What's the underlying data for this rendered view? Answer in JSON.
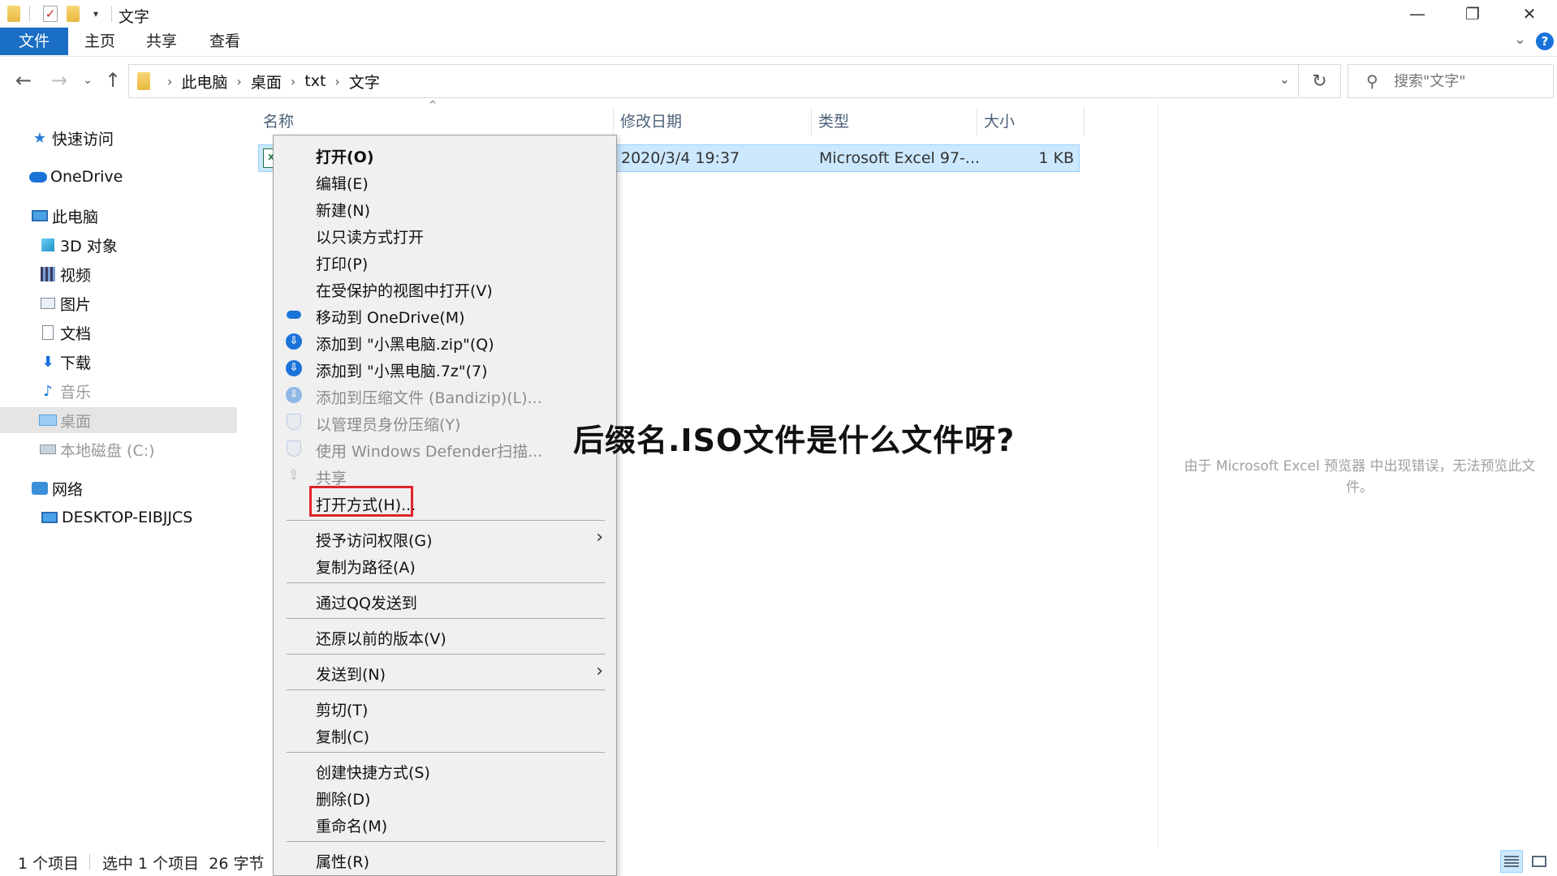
{
  "window": {
    "title": "文字",
    "controls": {
      "minimize": "—",
      "maximize": "❐",
      "close": "✕"
    }
  },
  "ribbon": {
    "tabs": [
      "文件",
      "主页",
      "共享",
      "查看"
    ],
    "help": "?"
  },
  "address": {
    "breadcrumbs": [
      "此电脑",
      "桌面",
      "txt",
      "文字"
    ],
    "search_placeholder": "搜索\"文字\""
  },
  "nav": {
    "items": [
      {
        "label": "快速访问",
        "icon": "star-icon"
      },
      {
        "label": "OneDrive",
        "icon": "onedrive-icon"
      },
      {
        "label": "此电脑",
        "icon": "this-pc-icon"
      },
      {
        "label": "3D 对象",
        "icon": "3d-objects-icon"
      },
      {
        "label": "视频",
        "icon": "video-icon"
      },
      {
        "label": "图片",
        "icon": "pictures-icon"
      },
      {
        "label": "文档",
        "icon": "documents-icon"
      },
      {
        "label": "下载",
        "icon": "download-icon"
      },
      {
        "label": "音乐",
        "icon": "music-icon"
      },
      {
        "label": "桌面",
        "icon": "desktop-icon"
      },
      {
        "label": "本地磁盘 (C:)",
        "icon": "drive-icon"
      },
      {
        "label": "网络",
        "icon": "network-icon"
      },
      {
        "label": "DESKTOP-EIBJJCS",
        "icon": "computer-icon"
      }
    ]
  },
  "columns": [
    "名称",
    "修改日期",
    "类型",
    "大小"
  ],
  "file": {
    "modified": "2020/3/4 19:37",
    "type": "Microsoft Excel 97-...",
    "size": "1 KB"
  },
  "context_menu": {
    "items": [
      "打开(O)",
      "编辑(E)",
      "新建(N)",
      "以只读方式打开",
      "打印(P)",
      "在受保护的视图中打开(V)",
      "移动到 OneDrive(M)",
      "添加到 \"小黑电脑.zip\"(Q)",
      "添加到 \"小黑电脑.7z\"(7)",
      "添加到压缩文件 (Bandizip)(L)...",
      "以管理员身份压缩(Y)",
      "使用 Windows Defender扫描...",
      "共享",
      "打开方式(H)...",
      "授予访问权限(G)",
      "复制为路径(A)",
      "通过QQ发送到",
      "还原以前的版本(V)",
      "发送到(N)",
      "剪切(T)",
      "复制(C)",
      "创建快捷方式(S)",
      "删除(D)",
      "重命名(M)",
      "属性(R)"
    ]
  },
  "preview": {
    "message": "由于 Microsoft Excel 预览器 中出现错误，无法预览此文件。"
  },
  "overlay": {
    "title": "后缀名.ISO文件是什么文件呀?"
  },
  "status": {
    "count": "1 个项目",
    "selected": "选中 1 个项目  26 字节"
  },
  "colors": {
    "accent": "#1a6fc4",
    "selection": "#cce8ff",
    "highlight_box": "#e0242a"
  }
}
